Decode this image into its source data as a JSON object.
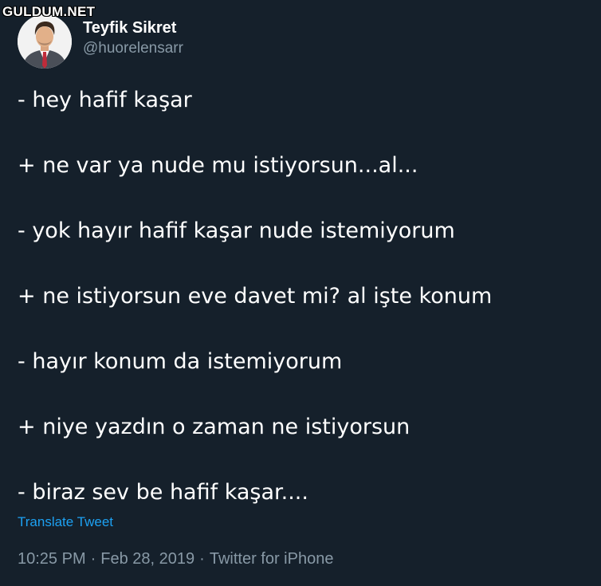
{
  "watermark": "GULDUM.NET",
  "tweet": {
    "author": {
      "display_name": "Teyfik Sikret",
      "handle": "@huorelensarr",
      "avatar_icon": "profile-photo-man-in-suit"
    },
    "lines": [
      "- hey hafif kaşar",
      "+ ne var ya nude mu istiyorsun...al...",
      "- yok hayır hafif kaşar nude istemiyorum",
      "+ ne istiyorsun eve davet mi? al işte konum",
      "- hayır konum da istemiyorum",
      "+ niye yazdın o zaman ne istiyorsun",
      "- biraz sev be hafif kaşar...."
    ],
    "translate_label": "Translate Tweet",
    "time": "10:25 PM",
    "date": "Feb 28, 2019",
    "separator": "·",
    "source": "Twitter for iPhone"
  },
  "colors": {
    "background": "#15202b",
    "text": "#ffffff",
    "secondary": "#8899a6",
    "link": "#1da1f2"
  }
}
